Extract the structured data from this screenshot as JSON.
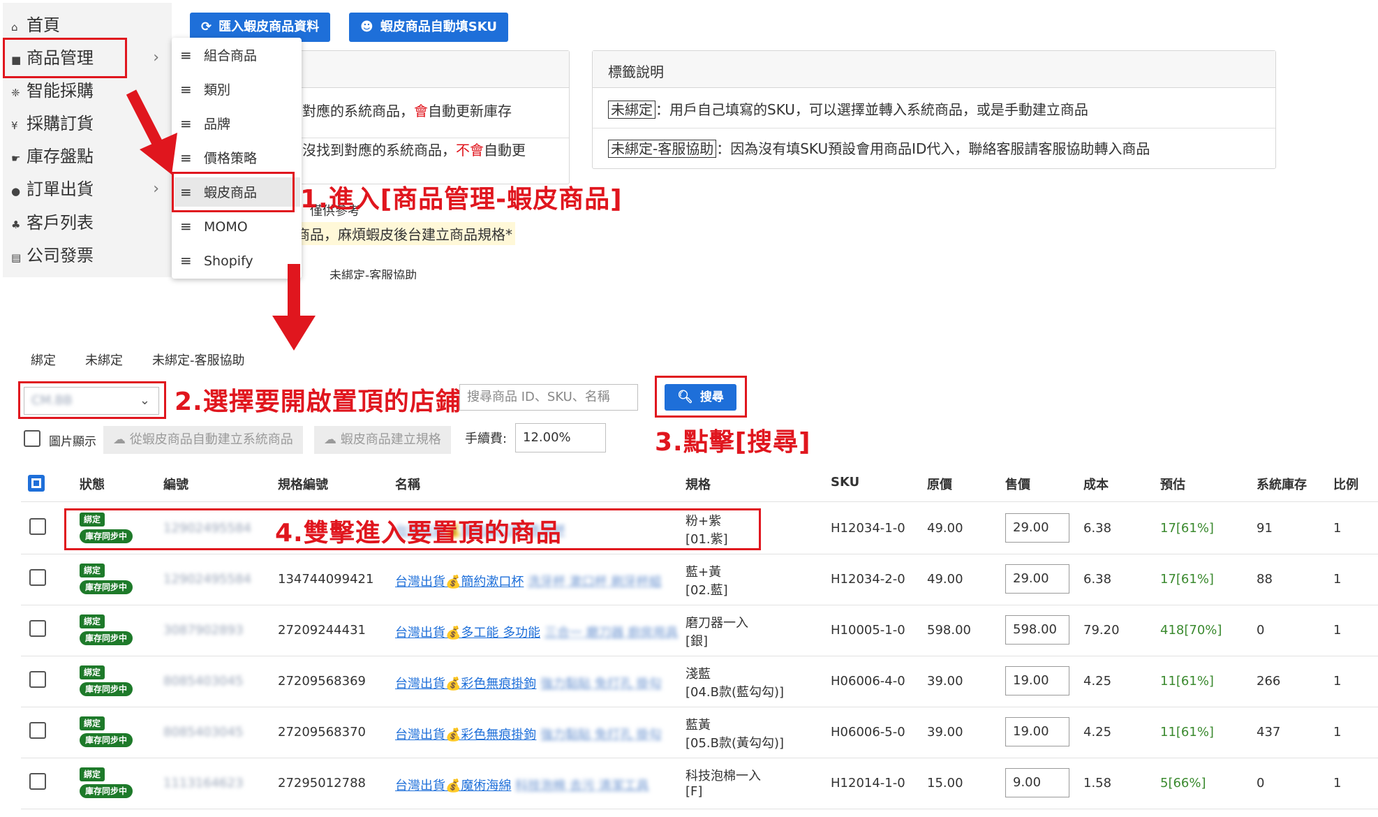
{
  "sidebar": {
    "items": [
      {
        "icon": "home-icon",
        "glyph": "⌂",
        "label": "首頁"
      },
      {
        "icon": "box-icon",
        "glyph": "■",
        "label": "商品管理"
      },
      {
        "icon": "ai-icon",
        "glyph": "❈",
        "label": "智能採購"
      },
      {
        "icon": "cart-icon",
        "glyph": "¥",
        "label": "採購訂貨"
      },
      {
        "icon": "scanner-icon",
        "glyph": "☛",
        "label": "庫存盤點"
      },
      {
        "icon": "bag-icon",
        "glyph": "●",
        "label": "訂單出貨"
      },
      {
        "icon": "users-icon",
        "glyph": "♣",
        "label": "客戶列表"
      },
      {
        "icon": "invoice-icon",
        "glyph": "▤",
        "label": "公司發票"
      }
    ],
    "submenu": [
      "組合商品",
      "類別",
      "品牌",
      "價格策略",
      "蝦皮商品",
      "MOMO",
      "Shopify"
    ]
  },
  "toolbar": {
    "import_label": "匯入蝦皮商品資料",
    "autosku_label": "蝦皮商品自動填SKU"
  },
  "panel_left": {
    "line1_a": "對應的系統商品，",
    "line1_b": "會",
    "line1_c": "自動更新庫存",
    "line2_a": "沒找到對應的系統商品，",
    "line2_b": "不會",
    "line2_c": "自動更",
    "note1": "，僅供參考",
    "note2": "商品，麻煩蝦皮後台建立商品規格*",
    "note3": "未綁定-客服協助"
  },
  "panel_right": {
    "title": "標籤說明",
    "tag1": "未綁定",
    "desc1": "：用戶自己填寫的SKU，可以選擇並轉入系統商品，或是手動建立商品",
    "tag2": "未綁定-客服協助",
    "desc2": "：因為沒有填SKU預設會用商品ID代入，聯絡客服請客服協助轉入商品"
  },
  "annotations": {
    "step1": "1.進入[商品管理-蝦皮商品]",
    "step2": "2.選擇要開啟置頂的店鋪",
    "step3": "3.點擊[搜尋]",
    "step4": "4.雙擊進入要置頂的商品"
  },
  "tabs": [
    "綁定",
    "未綁定",
    "未綁定-客服協助"
  ],
  "filters": {
    "store_value": "CM.BB",
    "search_placeholder": "搜尋商品 ID、SKU、名稱",
    "search_label": "搜尋",
    "image_toggle": "圖片顯示",
    "auto_create": "從蝦皮商品自動建立系統商品",
    "create_spec": "蝦皮商品建立規格",
    "fee_label": "手續費:",
    "fee_value": "12.00%"
  },
  "table": {
    "headers": [
      "狀態",
      "編號",
      "規格編號",
      "名稱",
      "規格",
      "SKU",
      "原價",
      "售價",
      "成本",
      "預估",
      "系統庫存",
      "比例"
    ],
    "status_bound": "綁定",
    "status_sync": "庫存同步中",
    "rows": [
      {
        "id": "12902495584",
        "spec_id": "",
        "name_prefix": "",
        "name_main": "",
        "name_blur": "台灣出貨💰簡約漱口杯 洗牙杯",
        "spec_line1": "粉+紫",
        "spec_line2": "[01.紫]",
        "sku": "H12034-1-0",
        "orig": "49.00",
        "price": "29.00",
        "cost": "6.38",
        "est": "17[61%]",
        "stock": "91",
        "ratio": "1"
      },
      {
        "id": "12902495584",
        "spec_id": "134744099421",
        "name_prefix": "台灣出貨",
        "name_main": "💰簡約漱口杯",
        "name_blur": "洗牙杯 漱口杯 刷牙杯組",
        "spec_line1": "藍+黃",
        "spec_line2": "[02.藍]",
        "sku": "H12034-2-0",
        "orig": "49.00",
        "price": "29.00",
        "cost": "6.38",
        "est": "17[61%]",
        "stock": "88",
        "ratio": "1"
      },
      {
        "id": "3087902893",
        "spec_id": "27209244431",
        "name_prefix": "台灣出貨",
        "name_main": "💰多工能 多功能",
        "name_blur": "三合一 磨刀器 廚房用具",
        "spec_line1": "磨刀器一入",
        "spec_line2": "[銀]",
        "sku": "H10005-1-0",
        "orig": "598.00",
        "price": "598.00",
        "cost": "79.20",
        "est": "418[70%]",
        "stock": "0",
        "ratio": "1"
      },
      {
        "id": "8085403045",
        "spec_id": "27209568369",
        "name_prefix": "台灣出貨",
        "name_main": "💰彩色無痕掛鉤",
        "name_blur": "強力黏貼 免打孔 掛勾",
        "spec_line1": "淺藍",
        "spec_line2": "[04.B款(藍勾勾)]",
        "sku": "H06006-4-0",
        "orig": "39.00",
        "price": "19.00",
        "cost": "4.25",
        "est": "11[61%]",
        "stock": "266",
        "ratio": "1"
      },
      {
        "id": "8085403045",
        "spec_id": "27209568370",
        "name_prefix": "台灣出貨",
        "name_main": "💰彩色無痕掛鉤",
        "name_blur": "強力黏貼 免打孔 掛勾",
        "spec_line1": "藍黃",
        "spec_line2": "[05.B款(黃勾勾)]",
        "sku": "H06006-5-0",
        "orig": "39.00",
        "price": "19.00",
        "cost": "4.25",
        "est": "11[61%]",
        "stock": "437",
        "ratio": "1"
      },
      {
        "id": "1113164623",
        "spec_id": "27295012788",
        "name_prefix": "台灣出貨",
        "name_main": "💰魔術海綿",
        "name_blur": "科技泡棉 去污 清潔工具",
        "spec_line1": "科技泡棉一入",
        "spec_line2": "[F]",
        "sku": "H12014-1-0",
        "orig": "15.00",
        "price": "9.00",
        "cost": "1.58",
        "est": "5[66%]",
        "stock": "0",
        "ratio": "1"
      }
    ]
  },
  "colors": {
    "accent": "#1e6fd9",
    "annotation": "#e0161e",
    "status_green": "#1e7a2a"
  }
}
